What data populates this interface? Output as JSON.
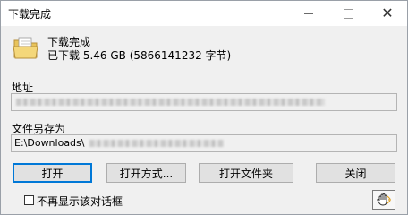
{
  "window": {
    "title": "下载完成"
  },
  "header": {
    "title": "下载完成",
    "size_text": "已下载 5.46 GB (5866141232 字节)"
  },
  "address": {
    "label": "地址",
    "value": ""
  },
  "save_as": {
    "label": "文件另存为",
    "value": "E:\\Downloads\\"
  },
  "buttons": {
    "open": "打开",
    "open_with": "打开方式...",
    "open_folder": "打开文件夹",
    "close": "关闭"
  },
  "options": {
    "dont_show_label": "不再显示该对话框",
    "dont_show_checked": false
  },
  "icons": {
    "header": "folder-icon",
    "corner": "hand-icon"
  },
  "colors": {
    "focus_border": "#0078d7",
    "dialog_bg": "#f0f0f0"
  }
}
